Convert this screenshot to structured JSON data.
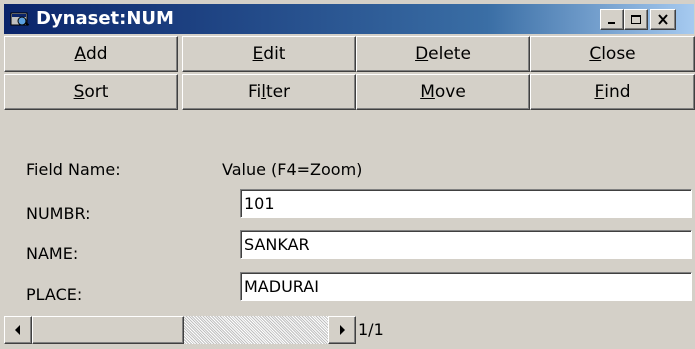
{
  "window": {
    "title": "Dynaset:NUM"
  },
  "toolbar": {
    "row1": [
      {
        "pre": "",
        "u": "A",
        "post": "dd"
      },
      {
        "pre": "",
        "u": "E",
        "post": "dit"
      },
      {
        "pre": "",
        "u": "D",
        "post": "elete"
      },
      {
        "pre": "",
        "u": "C",
        "post": "lose"
      }
    ],
    "row2": [
      {
        "pre": "",
        "u": "S",
        "post": "ort"
      },
      {
        "pre": "Fi",
        "u": "l",
        "post": "ter"
      },
      {
        "pre": "",
        "u": "M",
        "post": "ove"
      },
      {
        "pre": "",
        "u": "F",
        "post": "ind"
      }
    ]
  },
  "header": {
    "field_name": "Field Name:",
    "value": "Value (F4=Zoom)"
  },
  "fields": [
    {
      "label": "NUMBR:",
      "value": "101"
    },
    {
      "label": "NAME:",
      "value": "SANKAR"
    },
    {
      "label": "PLACE:",
      "value": "MADURAI"
    }
  ],
  "status": {
    "record": "1/1"
  },
  "icons": {
    "app": "dynaset-icon",
    "min": "minimize-icon",
    "max": "maximize-icon",
    "close": "close-icon"
  }
}
